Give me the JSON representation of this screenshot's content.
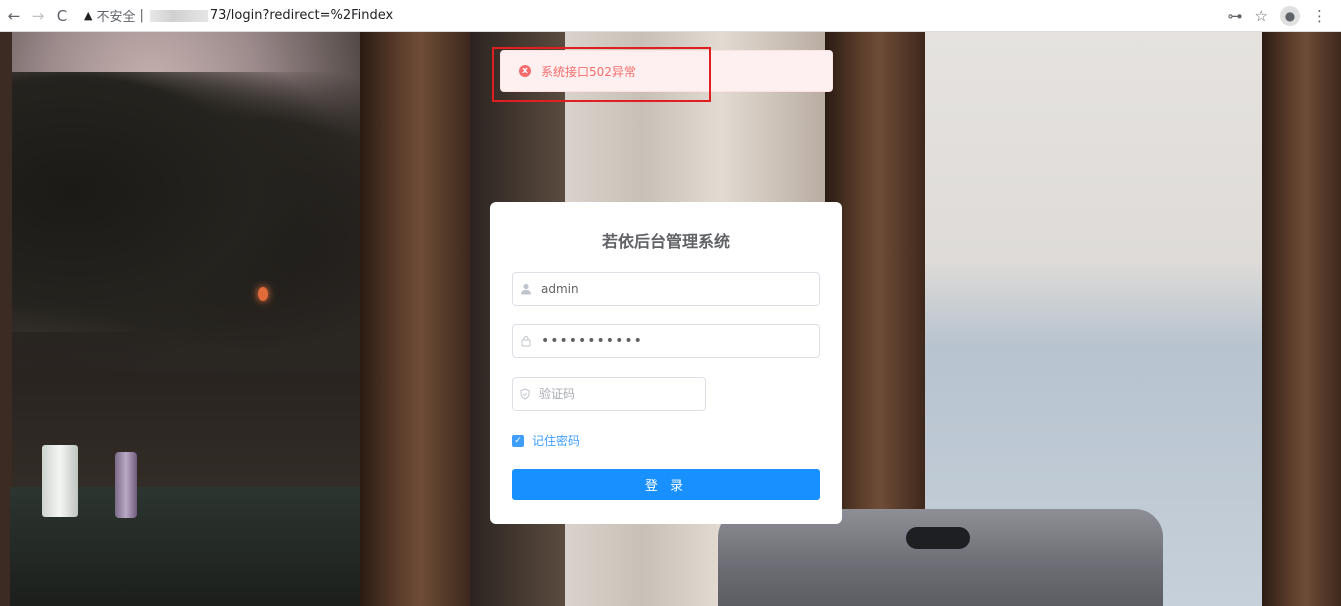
{
  "browser": {
    "back_icon": "←",
    "forward_icon": "→",
    "reload_icon": "C",
    "warning_icon": "▲",
    "insecure_label": "不安全",
    "separator": "|",
    "url_visible": "73/login?redirect=%2Findex",
    "key_icon": "⊶",
    "star_icon": "☆",
    "profile_icon": "●",
    "menu_icon": "⋮"
  },
  "toast": {
    "icon": "x",
    "message": "系统接口502异常",
    "color": "#f56c6c"
  },
  "login": {
    "title": "若依后台管理系统",
    "username_value": "admin",
    "password_value": "•••••••••••",
    "captcha_placeholder": "验证码",
    "remember_label": "记住密码",
    "remember_checked": true,
    "login_button": "登 录",
    "accent_color": "#1890ff"
  }
}
